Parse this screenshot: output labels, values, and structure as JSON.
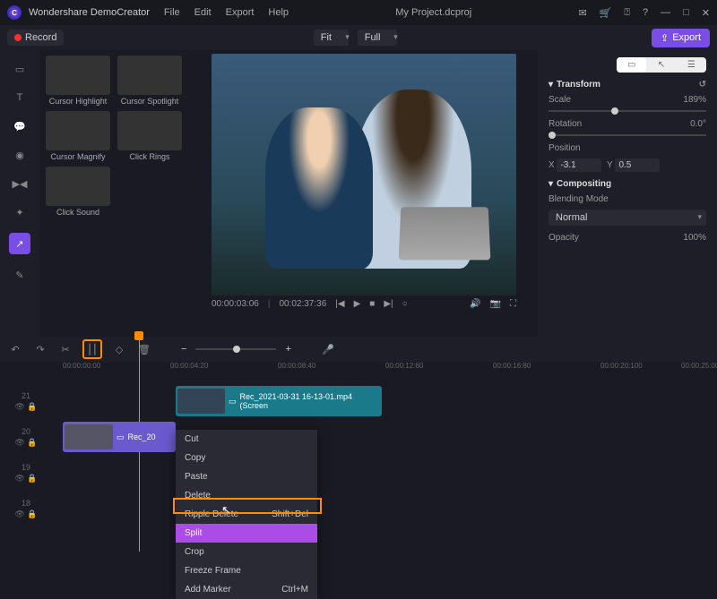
{
  "titlebar": {
    "app_name": "Wondershare DemoCreator",
    "menu": [
      "File",
      "Edit",
      "Export",
      "Help"
    ],
    "project": "My Project.dcproj"
  },
  "topbar": {
    "record": "Record",
    "fit_options": [
      "Fit"
    ],
    "fit_value": "Fit",
    "full_options": [
      "Full"
    ],
    "full_value": "Full",
    "export": "Export"
  },
  "library": [
    {
      "label": "Cursor Highlight"
    },
    {
      "label": "Cursor Spotlight"
    },
    {
      "label": "Cursor Magnify"
    },
    {
      "label": "Click Rings"
    },
    {
      "label": "Click Sound"
    }
  ],
  "preview": {
    "time_current": "00:00:03:06",
    "time_total": "00:02:37:36"
  },
  "props": {
    "transform": "Transform",
    "scale_label": "Scale",
    "scale_value": "189%",
    "rotation_label": "Rotation",
    "rotation_value": "0.0°",
    "position_label": "Position",
    "x_label": "X",
    "x_value": "-3.1",
    "y_label": "Y",
    "y_value": "0.5",
    "compositing": "Compositing",
    "blend_label": "Blending Mode",
    "blend_value": "Normal",
    "opacity_label": "Opacity",
    "opacity_value": "100%"
  },
  "ruler": [
    "00:00:00:00",
    "00:00:04:20",
    "00:00:08:40",
    "00:00:12:60",
    "00:00:16:80",
    "00:00:20:100",
    "00:00:25:00"
  ],
  "tracks": {
    "t21": "21",
    "t20": "20",
    "t19": "19",
    "t18": "18"
  },
  "clips": {
    "teal_label": "Rec_2021-03-31 16-13-01.mp4 (Screen",
    "purple_label": "Rec_20"
  },
  "ctx": {
    "cut": "Cut",
    "copy": "Copy",
    "paste": "Paste",
    "delete": "Delete",
    "ripple_delete": "Ripple Delete",
    "ripple_delete_sc": "Shift+Del",
    "split": "Split",
    "crop": "Crop",
    "freeze": "Freeze Frame",
    "marker": "Add Marker",
    "marker_sc": "Ctrl+M"
  }
}
